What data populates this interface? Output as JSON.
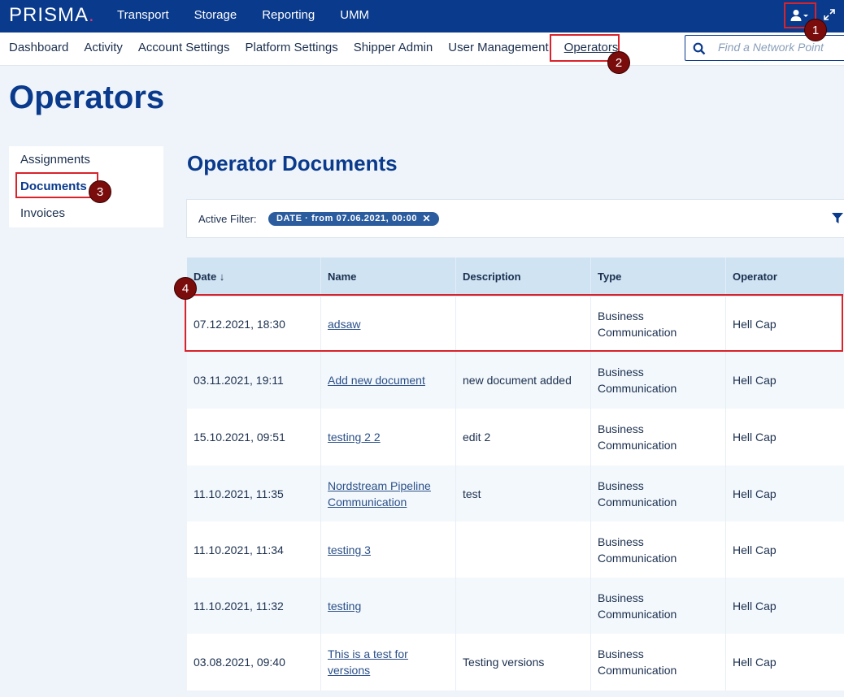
{
  "app": {
    "logo": "PRISMA",
    "logo_dot": "."
  },
  "topnav": [
    "Transport",
    "Storage",
    "Reporting",
    "UMM"
  ],
  "subnav": {
    "items": [
      "Dashboard",
      "Activity",
      "Account Settings",
      "Platform Settings",
      "Shipper Admin",
      "User Management",
      "Operators"
    ],
    "active": "Operators",
    "search_placeholder": "Find a Network Point"
  },
  "page": {
    "title": "Operators",
    "section_title": "Operator Documents"
  },
  "leftnav": {
    "items": [
      "Assignments",
      "Documents",
      "Invoices"
    ],
    "active": "Documents"
  },
  "filter": {
    "label": "Active Filter:",
    "chip": "DATE · from 07.06.2021, 00:00",
    "chip_close": "✕"
  },
  "table": {
    "headers": [
      "Date ↓",
      "Name",
      "Description",
      "Type",
      "Operator"
    ],
    "rows": [
      {
        "date": "07.12.2021, 18:30",
        "name": [
          "adsaw"
        ],
        "description": "",
        "type": [
          "Business",
          "Communication"
        ],
        "operator": "Hell Cap"
      },
      {
        "date": "03.11.2021, 19:11",
        "name": [
          "Add new document"
        ],
        "description": "new document added",
        "type": [
          "Business",
          "Communication"
        ],
        "operator": "Hell Cap"
      },
      {
        "date": "15.10.2021, 09:51",
        "name": [
          "testing 2 2"
        ],
        "description": "edit 2",
        "type": [
          "Business",
          "Communication"
        ],
        "operator": "Hell Cap"
      },
      {
        "date": "11.10.2021, 11:35",
        "name": [
          "Nordstream Pipeline",
          "Communication"
        ],
        "description": "test",
        "type": [
          "Business",
          "Communication"
        ],
        "operator": "Hell Cap"
      },
      {
        "date": "11.10.2021, 11:34",
        "name": [
          "testing 3"
        ],
        "description": "",
        "type": [
          "Business",
          "Communication"
        ],
        "operator": "Hell Cap"
      },
      {
        "date": "11.10.2021, 11:32",
        "name": [
          "testing"
        ],
        "description": "",
        "type": [
          "Business",
          "Communication"
        ],
        "operator": "Hell Cap"
      },
      {
        "date": "03.08.2021, 09:40",
        "name": [
          "This is a test for",
          "versions"
        ],
        "description": "Testing versions",
        "type": [
          "Business",
          "Communication"
        ],
        "operator": "Hell Cap"
      }
    ]
  },
  "annotations": [
    "1",
    "2",
    "3",
    "4"
  ],
  "colors": {
    "brand": "#0a3a8c",
    "accent": "#e8357a",
    "highlight": "#d9232b",
    "header_bg": "#cfe3f3"
  },
  "icons": {
    "user": "user-icon",
    "expand": "expand-icon",
    "search": "search-icon",
    "filter": "filter-icon"
  }
}
